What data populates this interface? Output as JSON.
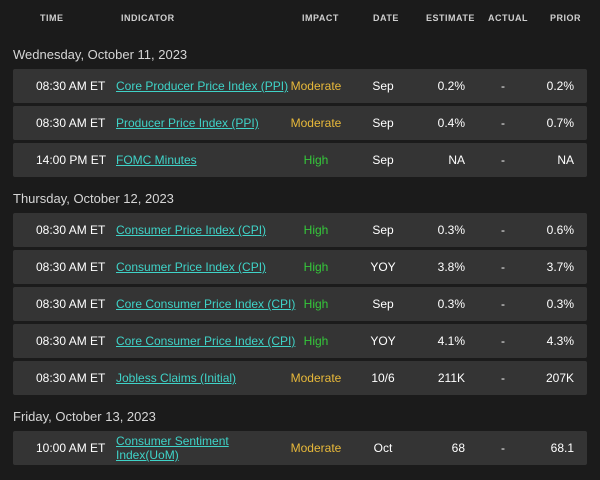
{
  "header": {
    "time": "TIME",
    "indicator": "INDICATOR",
    "impact": "IMPACT",
    "date": "DATE",
    "estimate": "ESTIMATE",
    "actual": "ACTUAL",
    "prior": "PRIOR"
  },
  "colors": {
    "background": "#1b1b1b",
    "row_background": "#343434",
    "link": "#3fd3c8",
    "impact_high": "#35c83a",
    "impact_moderate": "#e8b93a"
  },
  "days": [
    {
      "title": "Wednesday, October 11, 2023",
      "rows": [
        {
          "time": "08:30 AM ET",
          "indicator": "Core Producer Price Index (PPI)",
          "impact": "Moderate",
          "date": "Sep",
          "estimate": "0.2%",
          "actual": "-",
          "prior": "0.2%"
        },
        {
          "time": "08:30 AM ET",
          "indicator": "Producer Price Index (PPI)",
          "impact": "Moderate",
          "date": "Sep",
          "estimate": "0.4%",
          "actual": "-",
          "prior": "0.7%"
        },
        {
          "time": "14:00 PM ET",
          "indicator": "FOMC Minutes",
          "impact": "High",
          "date": "Sep",
          "estimate": "NA",
          "actual": "-",
          "prior": "NA"
        }
      ]
    },
    {
      "title": "Thursday, October 12, 2023",
      "rows": [
        {
          "time": "08:30 AM ET",
          "indicator": "Consumer Price Index (CPI)",
          "impact": "High",
          "date": "Sep",
          "estimate": "0.3%",
          "actual": "-",
          "prior": "0.6%"
        },
        {
          "time": "08:30 AM ET",
          "indicator": "Consumer Price Index (CPI)",
          "impact": "High",
          "date": "YOY",
          "estimate": "3.8%",
          "actual": "-",
          "prior": "3.7%"
        },
        {
          "time": "08:30 AM ET",
          "indicator": "Core Consumer Price Index (CPI)",
          "impact": "High",
          "date": "Sep",
          "estimate": "0.3%",
          "actual": "-",
          "prior": "0.3%"
        },
        {
          "time": "08:30 AM ET",
          "indicator": "Core Consumer Price Index (CPI)",
          "impact": "High",
          "date": "YOY",
          "estimate": "4.1%",
          "actual": "-",
          "prior": "4.3%"
        },
        {
          "time": "08:30 AM ET",
          "indicator": "Jobless Claims (Initial)",
          "impact": "Moderate",
          "date": "10/6",
          "estimate": "211K",
          "actual": "-",
          "prior": "207K"
        }
      ]
    },
    {
      "title": "Friday, October 13, 2023",
      "rows": [
        {
          "time": "10:00 AM ET",
          "indicator": "Consumer Sentiment Index(UoM)",
          "impact": "Moderate",
          "date": "Oct",
          "estimate": "68",
          "actual": "-",
          "prior": "68.1"
        }
      ]
    }
  ]
}
